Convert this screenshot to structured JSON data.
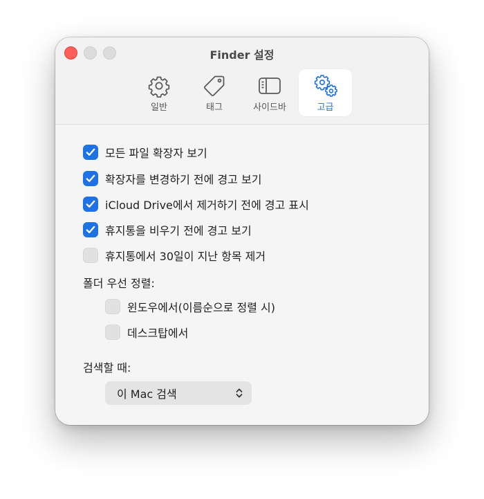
{
  "window": {
    "title": "Finder 설정"
  },
  "tabs": [
    {
      "label": "일반",
      "icon": "gear-icon",
      "active": false
    },
    {
      "label": "태그",
      "icon": "tag-icon",
      "active": false
    },
    {
      "label": "사이드바",
      "icon": "sidebar-icon",
      "active": false
    },
    {
      "label": "고급",
      "icon": "gears-icon",
      "active": true
    }
  ],
  "options": [
    {
      "label": "모든 파일 확장자 보기",
      "checked": true
    },
    {
      "label": "확장자를 변경하기 전에 경고 보기",
      "checked": true
    },
    {
      "label": "iCloud Drive에서 제거하기 전에 경고 표시",
      "checked": true
    },
    {
      "label": "휴지통을 비우기 전에 경고 보기",
      "checked": true
    },
    {
      "label": "휴지통에서 30일이 지난 항목 제거",
      "checked": false
    }
  ],
  "folder_sort": {
    "heading": "폴더 우선 정렬:",
    "options": [
      {
        "label": "윈도우에서(이름순으로 정렬 시)",
        "checked": false
      },
      {
        "label": "데스크탑에서",
        "checked": false
      }
    ]
  },
  "search": {
    "heading": "검색할 때:",
    "selected": "이 Mac 검색"
  },
  "colors": {
    "accent": "#1f72e6",
    "close": "#ff5f57"
  }
}
